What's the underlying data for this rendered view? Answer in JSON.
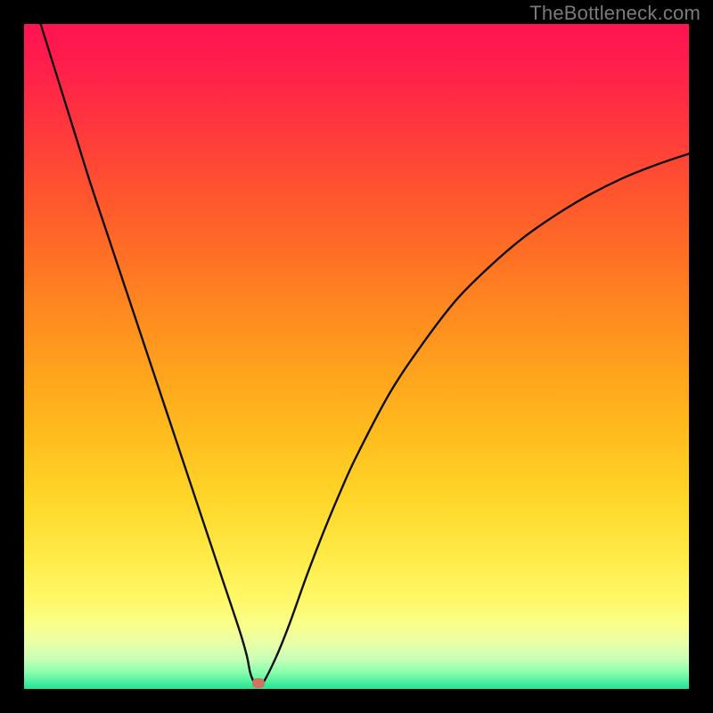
{
  "watermark": {
    "text": "TheBottleneck.com"
  },
  "chart_data": {
    "type": "line",
    "title": "",
    "xlabel": "",
    "ylabel": "",
    "xlim": [
      0,
      100
    ],
    "ylim": [
      0,
      100
    ],
    "grid": false,
    "legend": false,
    "series": [
      {
        "name": "bottleneck-curve",
        "x": [
          2.5,
          5,
          7.5,
          10,
          12.5,
          15,
          17.5,
          20,
          22.5,
          25,
          27.5,
          30,
          32.5,
          33.5,
          34,
          34.5,
          35,
          35.5,
          36,
          38,
          40,
          42.5,
          45,
          47.5,
          50,
          55,
          60,
          65,
          70,
          75,
          80,
          85,
          90,
          95,
          100
        ],
        "y": [
          100,
          92,
          84,
          76,
          68.5,
          61,
          53.5,
          46,
          38.5,
          31,
          23.5,
          16,
          8.5,
          5,
          2.5,
          1.2,
          0.9,
          0.9,
          1,
          5,
          10,
          17,
          23.5,
          29.5,
          35,
          44.5,
          52,
          58.5,
          63.5,
          67.8,
          71.3,
          74.3,
          76.8,
          78.8,
          80.5
        ]
      }
    ],
    "marker": {
      "x": 35.2,
      "y": 0.9,
      "name": "optimal-point"
    },
    "background_gradient": {
      "stops": [
        {
          "pos": 0,
          "color": "#ff1452"
        },
        {
          "pos": 0.5,
          "color": "#ffbd1e"
        },
        {
          "pos": 0.9,
          "color": "#faff86"
        },
        {
          "pos": 1,
          "color": "#23e493"
        }
      ]
    }
  }
}
